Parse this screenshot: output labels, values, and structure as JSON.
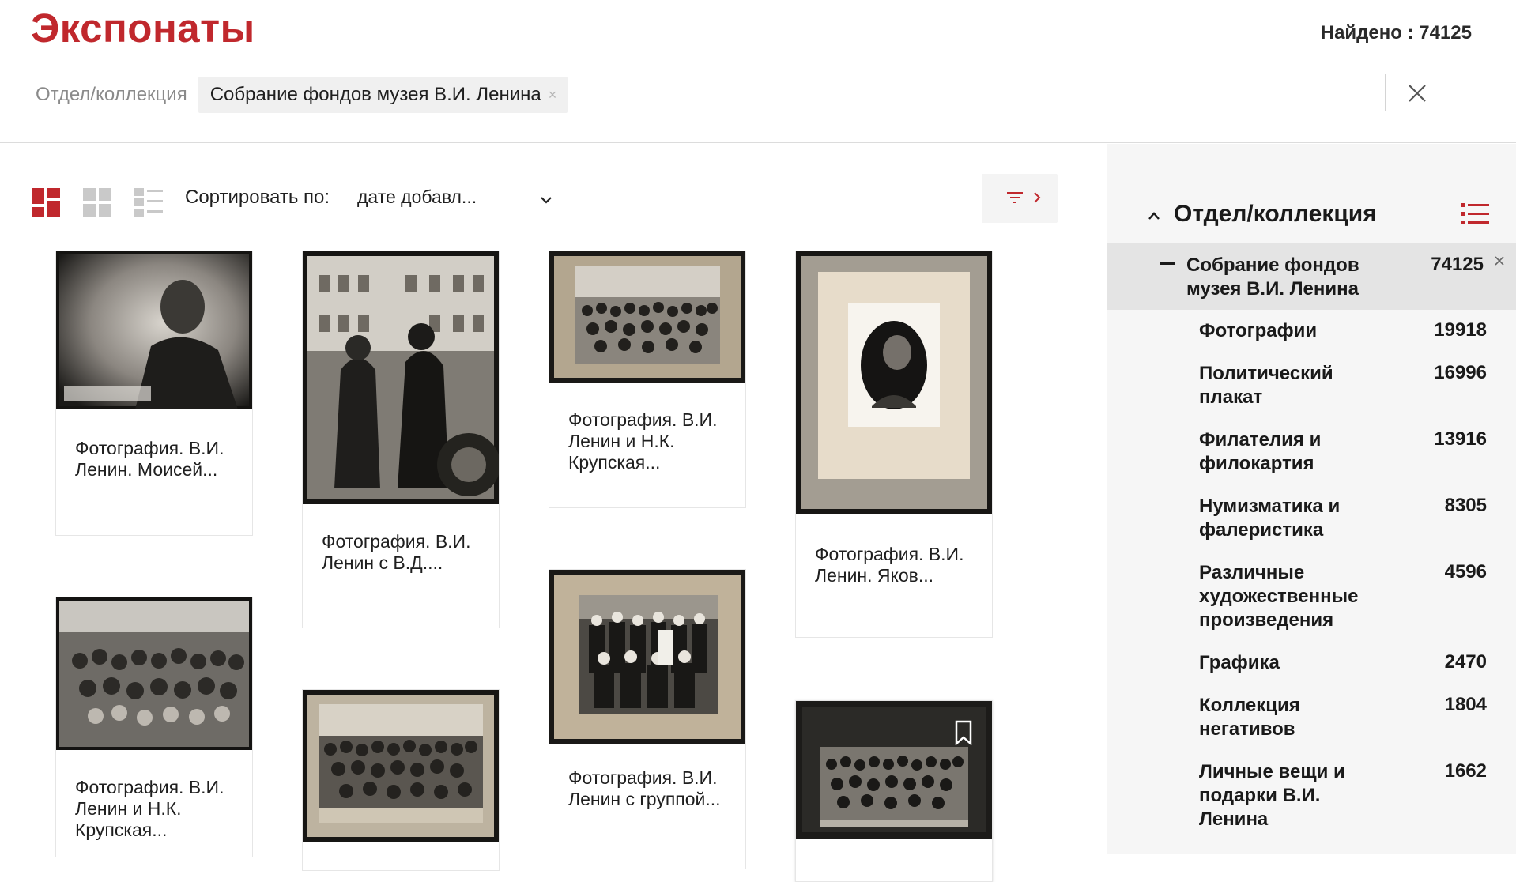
{
  "header": {
    "title": "Экспонаты",
    "found": "Найдено : 74125",
    "filter_label": "Отдел/коллекция",
    "filter_chip": "Собрание фондов музея В.И. Ленина",
    "chip_close": "×"
  },
  "toolbar": {
    "sort_label": "Сортировать по:",
    "sort_value": "дате добавл..."
  },
  "cards": [
    {
      "caption": "Фотография. В.И. Ленин. Моисей..."
    },
    {
      "caption": "Фотография. В.И. Ленин с В.Д...."
    },
    {
      "caption": "Фотография. В.И. Ленин и Н.К. Крупская..."
    },
    {
      "caption": "Фотография. В.И. Ленин. Яков..."
    },
    {
      "caption": "Фотография. В.И. Ленин и Н.К. Крупская..."
    },
    {
      "caption": ""
    },
    {
      "caption": "Фотография. В.И. Ленин с группой..."
    },
    {
      "caption": ""
    }
  ],
  "sidebar": {
    "title": "Отдел/коллекция",
    "selected": {
      "label": "Собрание фондов музея В.И. Ленина",
      "count": "74125"
    },
    "items": [
      {
        "label": "Фотографии",
        "count": "19918"
      },
      {
        "label": "Политический плакат",
        "count": "16996"
      },
      {
        "label": "Филателия и филокартия",
        "count": "13916"
      },
      {
        "label": "Нумизматика и фалеристика",
        "count": "8305"
      },
      {
        "label": "Различные художественные произведения",
        "count": "4596"
      },
      {
        "label": "Графика",
        "count": "2470"
      },
      {
        "label": "Коллекция негативов",
        "count": "1804"
      },
      {
        "label": "Личные вещи и подарки В.И. Ленина",
        "count": "1662"
      }
    ]
  },
  "colors": {
    "accent": "#c0282d",
    "sidebar_bg": "#f6f6f6",
    "selected_bg": "#e4e4e4"
  },
  "icons": [
    "grid-masonry-icon",
    "grid-tiles-icon",
    "list-view-icon",
    "chevron-down-icon",
    "filter-icon",
    "chevron-right-icon",
    "close-icon",
    "chevron-up-icon",
    "list-icon",
    "bookmark-icon"
  ]
}
